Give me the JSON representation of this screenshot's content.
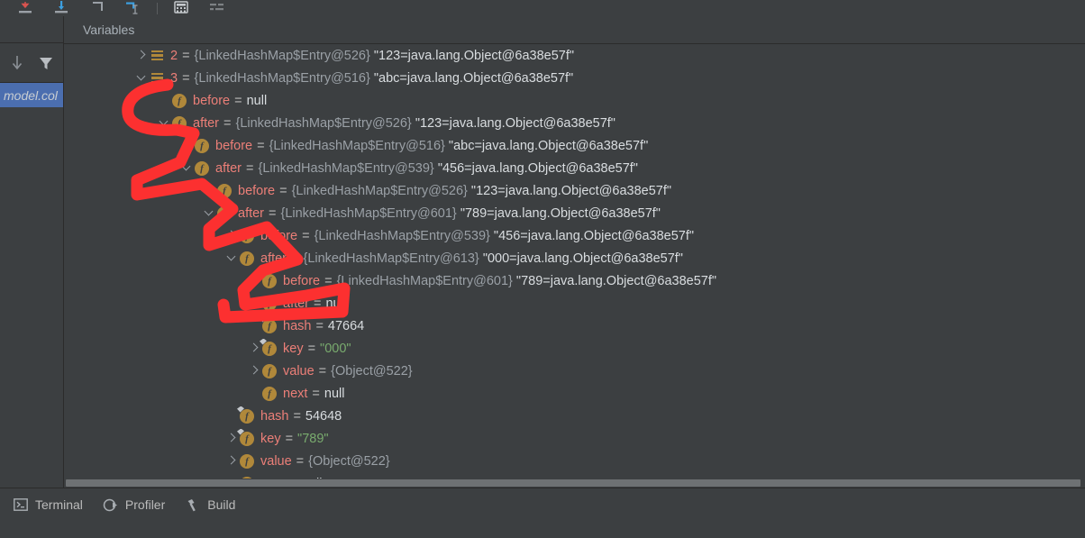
{
  "toolbar": {
    "buttons": [
      {
        "name": "step-over-icon",
        "label": "Step Over"
      },
      {
        "name": "step-into-icon",
        "label": "Step Into"
      },
      {
        "name": "step-out-icon",
        "label": "Step Out"
      },
      {
        "name": "run-to-cursor-icon",
        "label": "Run to Cursor"
      },
      {
        "name": "evaluate-expression-icon",
        "label": "Evaluate Expression"
      },
      {
        "name": "layout-settings-icon",
        "label": "Layout Settings"
      }
    ]
  },
  "left_rail": {
    "sort_icon": "arrow-down-icon",
    "filter_icon": "filter-icon",
    "chip_label": "model.col"
  },
  "panel": {
    "header": "Variables"
  },
  "tree": {
    "rows": [
      {
        "indent": 0,
        "twisty": "right",
        "icon": "array-entry-icon",
        "name": "2",
        "name_kind": "index",
        "ref": "{LinkedHashMap$Entry@526}",
        "value": "\"123=java.lang.Object@6a38e57f\"",
        "value_kind": "string"
      },
      {
        "indent": 0,
        "twisty": "down",
        "icon": "array-entry-icon",
        "name": "3",
        "name_kind": "index",
        "ref": "{LinkedHashMap$Entry@516}",
        "value": "\"abc=java.lang.Object@6a38e57f\"",
        "value_kind": "string"
      },
      {
        "indent": 1,
        "twisty": "none",
        "icon": "field-icon",
        "name": "before",
        "name_kind": "field",
        "ref": "",
        "value": "null",
        "value_kind": "null"
      },
      {
        "indent": 1,
        "twisty": "down",
        "icon": "field-icon",
        "name": "after",
        "name_kind": "field",
        "ref": "{LinkedHashMap$Entry@526}",
        "value": "\"123=java.lang.Object@6a38e57f\"",
        "value_kind": "string"
      },
      {
        "indent": 2,
        "twisty": "none",
        "icon": "field-icon",
        "name": "before",
        "name_kind": "field",
        "ref": "{LinkedHashMap$Entry@516}",
        "value": "\"abc=java.lang.Object@6a38e57f\"",
        "value_kind": "string"
      },
      {
        "indent": 2,
        "twisty": "down",
        "icon": "field-icon",
        "name": "after",
        "name_kind": "field",
        "ref": "{LinkedHashMap$Entry@539}",
        "value": "\"456=java.lang.Object@6a38e57f\"",
        "value_kind": "string"
      },
      {
        "indent": 3,
        "twisty": "right",
        "icon": "field-icon",
        "name": "before",
        "name_kind": "field",
        "ref": "{LinkedHashMap$Entry@526}",
        "value": "\"123=java.lang.Object@6a38e57f\"",
        "value_kind": "string"
      },
      {
        "indent": 3,
        "twisty": "down",
        "icon": "field-icon",
        "name": "after",
        "name_kind": "field",
        "ref": "{LinkedHashMap$Entry@601}",
        "value": "\"789=java.lang.Object@6a38e57f\"",
        "value_kind": "string"
      },
      {
        "indent": 4,
        "twisty": "right",
        "icon": "field-icon",
        "name": "before",
        "name_kind": "field",
        "ref": "{LinkedHashMap$Entry@539}",
        "value": "\"456=java.lang.Object@6a38e57f\"",
        "value_kind": "string"
      },
      {
        "indent": 4,
        "twisty": "down",
        "icon": "field-icon",
        "name": "after",
        "name_kind": "field",
        "ref": "{LinkedHashMap$Entry@613}",
        "value": "\"000=java.lang.Object@6a38e57f\"",
        "value_kind": "string"
      },
      {
        "indent": 5,
        "twisty": "right",
        "icon": "field-icon",
        "name": "before",
        "name_kind": "field",
        "ref": "{LinkedHashMap$Entry@601}",
        "value": "\"789=java.lang.Object@6a38e57f\"",
        "value_kind": "string"
      },
      {
        "indent": 5,
        "twisty": "none",
        "icon": "field-icon",
        "name": "after",
        "name_kind": "field",
        "ref": "",
        "value": "null",
        "value_kind": "null"
      },
      {
        "indent": 5,
        "twisty": "none",
        "icon": "final-field-icon",
        "name": "hash",
        "name_kind": "field",
        "ref": "",
        "value": "47664",
        "value_kind": "number"
      },
      {
        "indent": 5,
        "twisty": "right",
        "icon": "final-field-icon",
        "name": "key",
        "name_kind": "field",
        "ref": "",
        "value": "\"000\"",
        "value_kind": "string-green"
      },
      {
        "indent": 5,
        "twisty": "right",
        "icon": "field-icon",
        "name": "value",
        "name_kind": "field",
        "ref": "{Object@522}",
        "value": "",
        "value_kind": "ref"
      },
      {
        "indent": 5,
        "twisty": "none",
        "icon": "field-icon",
        "name": "next",
        "name_kind": "field",
        "ref": "",
        "value": "null",
        "value_kind": "null"
      },
      {
        "indent": 4,
        "twisty": "none",
        "icon": "final-field-icon",
        "name": "hash",
        "name_kind": "field",
        "ref": "",
        "value": "54648",
        "value_kind": "number"
      },
      {
        "indent": 4,
        "twisty": "right",
        "icon": "final-field-icon",
        "name": "key",
        "name_kind": "field",
        "ref": "",
        "value": "\"789\"",
        "value_kind": "string-green"
      },
      {
        "indent": 4,
        "twisty": "right",
        "icon": "field-icon",
        "name": "value",
        "name_kind": "field",
        "ref": "{Object@522}",
        "value": "",
        "value_kind": "ref"
      },
      {
        "indent": 4,
        "twisty": "none",
        "icon": "field-icon",
        "name": "next",
        "name_kind": "field",
        "ref": "",
        "value": "null",
        "value_kind": "null"
      }
    ]
  },
  "statusbar": {
    "items": [
      {
        "icon": "terminal-icon",
        "label": "Terminal"
      },
      {
        "icon": "profiler-icon",
        "label": "Profiler"
      },
      {
        "icon": "build-hammer-icon",
        "label": "Build"
      }
    ]
  },
  "colors": {
    "background": "#3c3f41",
    "field_name": "#ec7f78",
    "reference": "#9aa0a6",
    "string_value": "#d9dde0",
    "string_literal": "#79ab6e",
    "icon_gold": "#b0883a",
    "selection_blue": "#4b6eaf",
    "annotation_red": "#fc3030"
  }
}
